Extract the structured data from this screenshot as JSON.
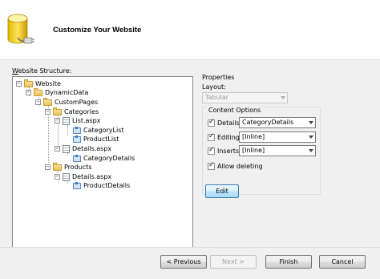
{
  "header": {
    "title": "Customize Your Website",
    "icon": "database-plug-icon"
  },
  "structure": {
    "label": "Website Structure:",
    "tree": [
      {
        "label": "Website",
        "icon": "folder-icon",
        "expander": "−"
      },
      {
        "label": "DynamicData",
        "icon": "folder-icon",
        "expander": "−"
      },
      {
        "label": "CustomPages",
        "icon": "folder-icon",
        "expander": "−"
      },
      {
        "label": "Categories",
        "icon": "folder-icon",
        "expander": "−"
      },
      {
        "label": "List.aspx",
        "icon": "page-icon",
        "expander": "−"
      },
      {
        "label": "CategoryList",
        "icon": "control-icon",
        "expander": ""
      },
      {
        "label": "ProductList",
        "icon": "control-icon",
        "expander": ""
      },
      {
        "label": "Details.aspx",
        "icon": "page-icon",
        "expander": "−"
      },
      {
        "label": "CategoryDetails",
        "icon": "control-icon",
        "expander": ""
      },
      {
        "label": "Products",
        "icon": "folder-icon",
        "expander": "−"
      },
      {
        "label": "Details.aspx",
        "icon": "page-icon",
        "expander": "−"
      },
      {
        "label": "ProductDetails",
        "icon": "control-icon",
        "expander": ""
      }
    ]
  },
  "properties": {
    "group_label": "Properties",
    "layout_label": "Layout:",
    "layout_value": "Tabular",
    "content_options_label": "Content Options",
    "options": [
      {
        "label": "Details",
        "checked": true,
        "value": "CategoryDetails"
      },
      {
        "label": "Editing",
        "checked": true,
        "value": "[Inline]"
      },
      {
        "label": "Inserts",
        "checked": true,
        "value": "[Inline]"
      }
    ],
    "allow_deleting_label": "Allow deleting",
    "allow_deleting_checked": true,
    "edit_button": "Edit"
  },
  "footer": {
    "previous": "< Previous",
    "next": "Next >",
    "finish": "Finish",
    "cancel": "Cancel"
  }
}
